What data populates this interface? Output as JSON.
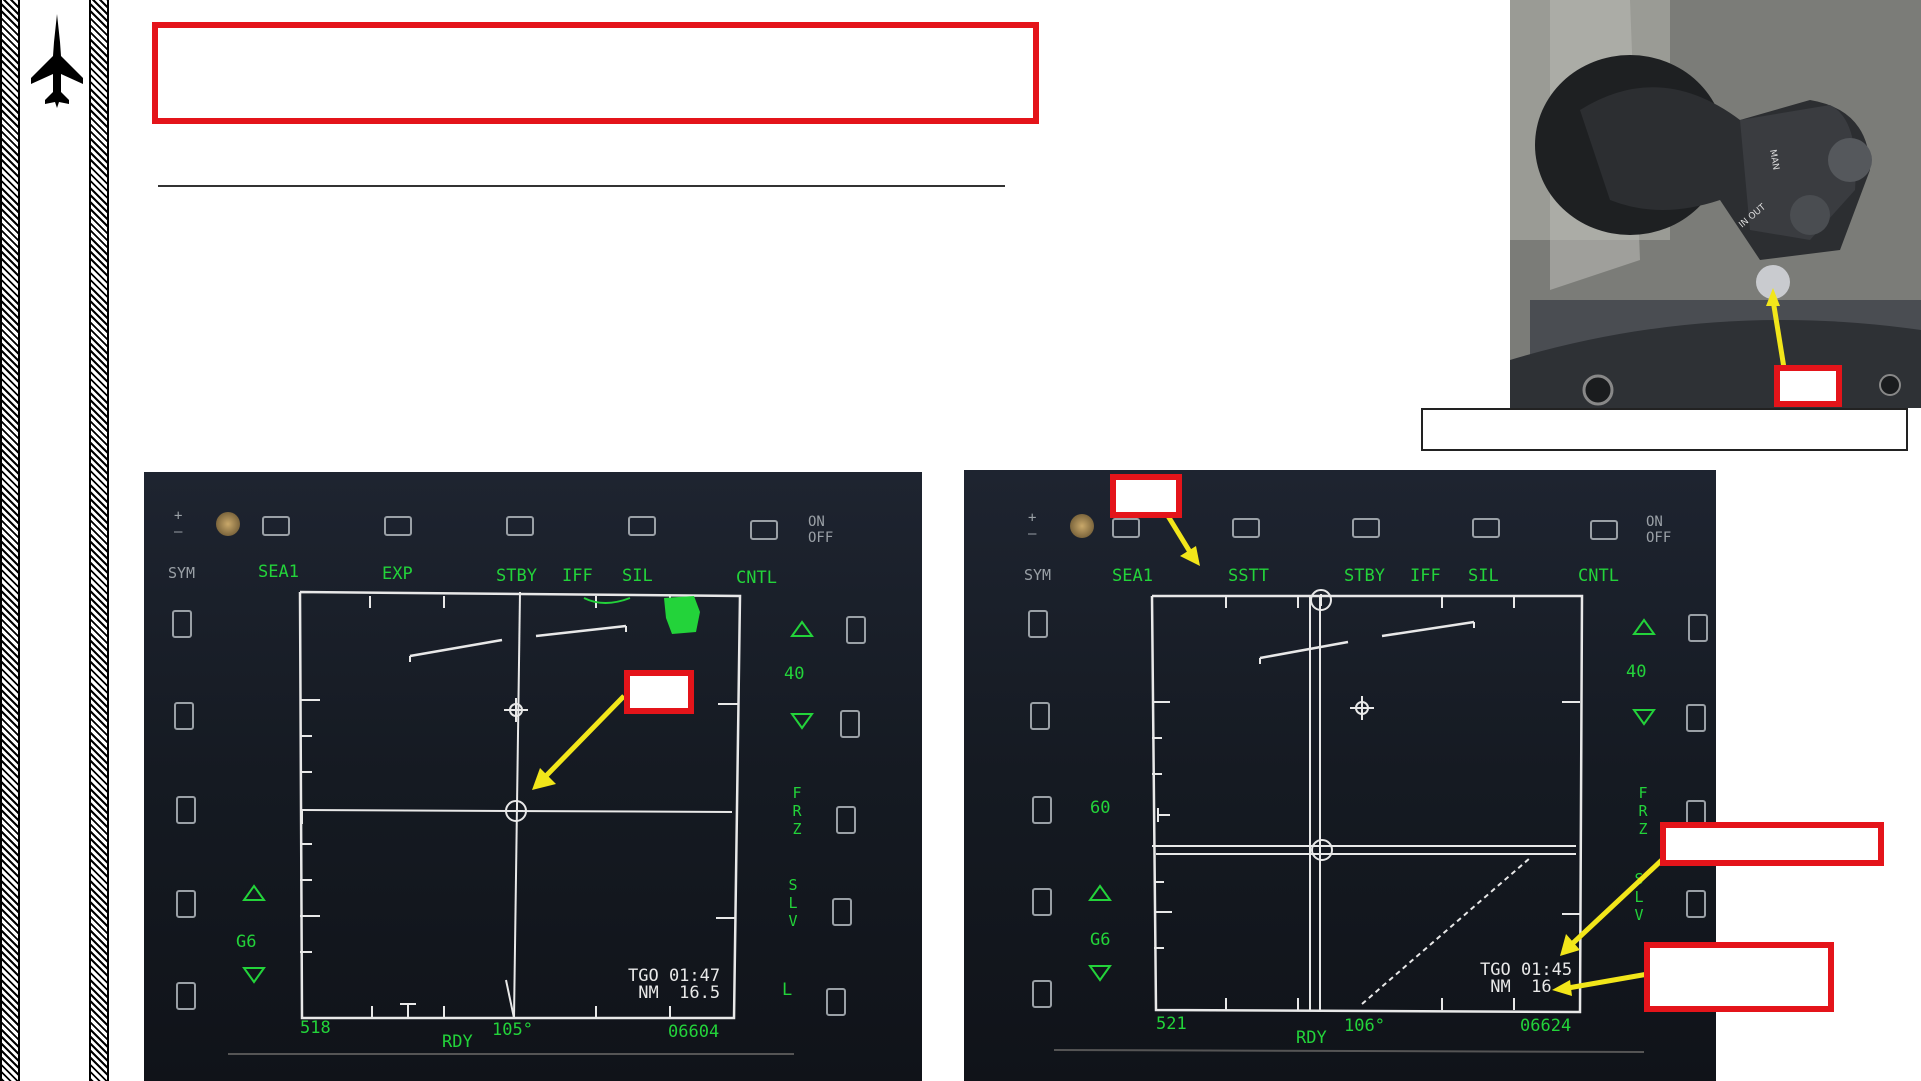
{
  "page": {
    "logo_icon": "fighter-jet-silhouette-icon"
  },
  "colors": {
    "callout_red": "#e4141a",
    "arrow_yellow": "#f2e61a",
    "mfd_green": "#23d33a",
    "mfd_white": "#e8e8e8",
    "mfd_background": "#10131a"
  },
  "left_mfd": {
    "top_labels": [
      "SEA1",
      "EXP",
      "STBY",
      "IFF",
      "SIL",
      "CNTL"
    ],
    "side_labels": {
      "sym": "SYM",
      "range": "40",
      "gain": "G6",
      "frz": "FRZ",
      "slv": "SLV",
      "l": "L",
      "on_off": "ON\nOFF"
    },
    "bottom": {
      "left_value": "518",
      "rdy": "RDY",
      "heading": "105°",
      "right_value": "06604"
    },
    "tgo": "TGO 01:47\n NM  16.5"
  },
  "right_mfd": {
    "top_labels": [
      "SEA1",
      "SSTT",
      "STBY",
      "IFF",
      "SIL",
      "CNTL"
    ],
    "side_labels": {
      "sym": "SYM",
      "range": "40",
      "left_range": "60",
      "gain": "G6",
      "frz": "FRZ",
      "slv": "SLV",
      "on_off": "ON\nOFF"
    },
    "bottom": {
      "left_value": "521",
      "rdy": "RDY",
      "heading": "106°",
      "right_value": "06624"
    },
    "tgo": "TGO 01:45\n NM  16"
  },
  "photo": {
    "description_icon": "throttle-grip-photo-icon",
    "markings": [
      "IN",
      "OUT",
      "MAN"
    ]
  }
}
